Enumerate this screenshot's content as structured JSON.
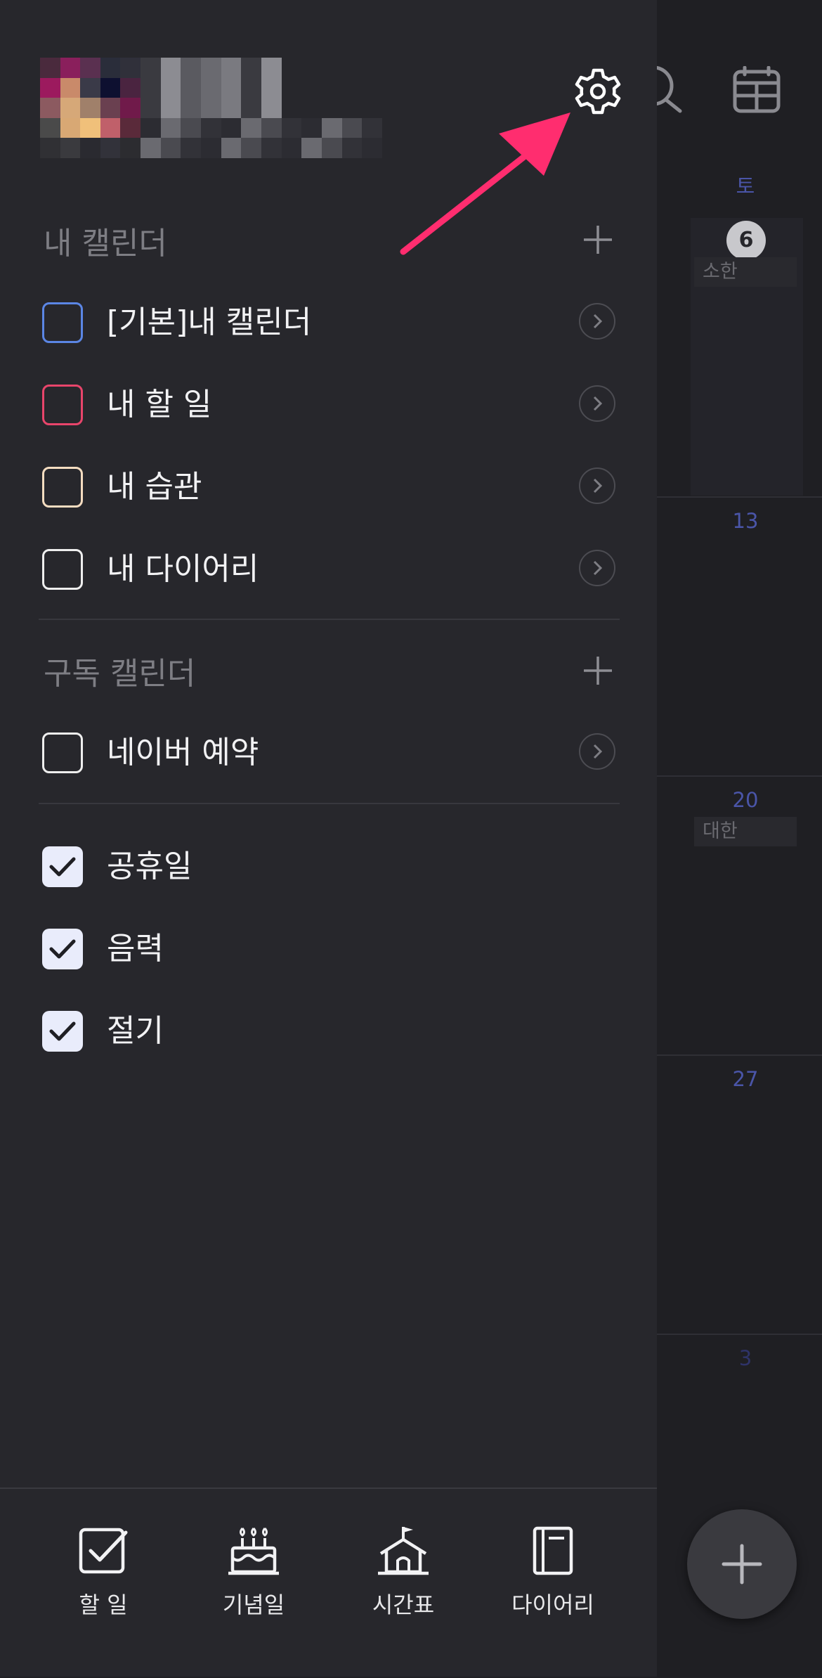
{
  "background_calendar": {
    "weekday_header": "토",
    "dates": [
      "6",
      "13",
      "20",
      "27",
      "3"
    ],
    "events": [
      {
        "date": "6",
        "label": "소한"
      },
      {
        "date": "20",
        "label": "대한"
      }
    ],
    "accent_color": "#4a55a8"
  },
  "header": {
    "avatar": "user-avatar (blurred)",
    "name": "",
    "email": ""
  },
  "sections": {
    "my_calendars": {
      "title": "내 캘린더",
      "items": [
        {
          "label": "[기본]내 캘린더",
          "color": "#5b86e5",
          "checked": false
        },
        {
          "label": "내 할 일",
          "color": "#e8456b",
          "checked": false
        },
        {
          "label": "내 습관",
          "color": "#f4dcc0",
          "checked": false
        },
        {
          "label": "내 다이어리",
          "color": "#eeeeee",
          "checked": false
        }
      ]
    },
    "subscribed_calendars": {
      "title": "구독 캘린더",
      "items": [
        {
          "label": "네이버 예약",
          "color": "#eeeeee",
          "checked": false
        }
      ]
    },
    "builtin_calendars": {
      "items": [
        {
          "label": "공휴일",
          "checked": true
        },
        {
          "label": "음력",
          "checked": true
        },
        {
          "label": "절기",
          "checked": true
        }
      ]
    }
  },
  "tabbar": {
    "tabs": [
      {
        "label": "할 일",
        "icon": "checkbox-icon"
      },
      {
        "label": "기념일",
        "icon": "cake-icon"
      },
      {
        "label": "시간표",
        "icon": "school-icon"
      },
      {
        "label": "다이어리",
        "icon": "notebook-icon"
      }
    ]
  },
  "annotation": {
    "type": "arrow",
    "color": "#ff2d6f",
    "target": "settings-gear"
  }
}
